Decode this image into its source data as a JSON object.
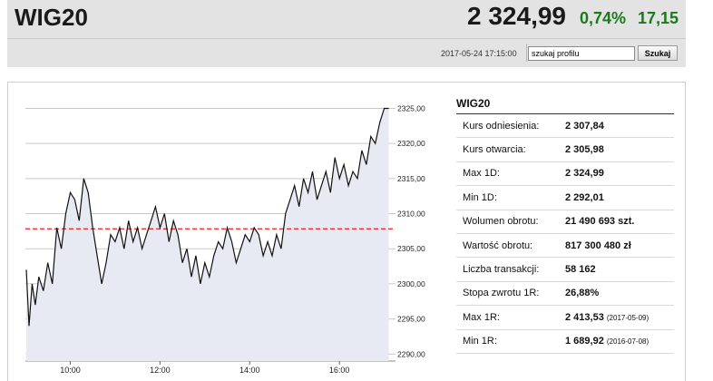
{
  "header": {
    "title": "WIG20",
    "price": "2 324,99",
    "change_pct": "0,74%",
    "change_abs": "17,15",
    "change_color": "#1a7a1a",
    "timestamp": "2017-05-24 17:15:00",
    "search_value": "szukaj profilu",
    "search_button": "Szukaj"
  },
  "stats": {
    "title": "WIG20",
    "rows": [
      {
        "label": "Kurs odniesienia:",
        "value": "2 307,84",
        "date": ""
      },
      {
        "label": "Kurs otwarcia:",
        "value": "2 305,98",
        "date": ""
      },
      {
        "label": "Max 1D:",
        "value": "2 324,99",
        "date": ""
      },
      {
        "label": "Min 1D:",
        "value": "2 292,01",
        "date": ""
      },
      {
        "label": "Wolumen obrotu:",
        "value": "21 490 693 szt.",
        "date": ""
      },
      {
        "label": "Wartość obrotu:",
        "value": "817 300 480 zł",
        "date": ""
      },
      {
        "label": "Liczba transakcji:",
        "value": "58 162",
        "date": ""
      },
      {
        "label": "Stopa zwrotu 1R:",
        "value": "26,88%",
        "date": ""
      },
      {
        "label": "Max 1R:",
        "value": "2 413,53",
        "date": "(2017-05-09)"
      },
      {
        "label": "Min 1R:",
        "value": "1 689,92",
        "date": "(2016-07-08)"
      }
    ]
  },
  "chart_data": {
    "type": "area",
    "title": "",
    "xlabel": "",
    "ylabel": "",
    "x_ticks": [
      {
        "label": "10:00",
        "hours": 10
      },
      {
        "label": "12:00",
        "hours": 12
      },
      {
        "label": "14:00",
        "hours": 14
      },
      {
        "label": "16:00",
        "hours": 16
      }
    ],
    "y_ticks": [
      "2325,00",
      "2320,00",
      "2315,00",
      "2310,00",
      "2305,00",
      "2300,00",
      "2295,00",
      "2290,00"
    ],
    "y_tick_values": [
      2325,
      2320,
      2315,
      2310,
      2305,
      2300,
      2295,
      2290
    ],
    "ylim": [
      2289,
      2327
    ],
    "xlim_hours": [
      9.0,
      17.25
    ],
    "reference_line": {
      "value": 2307.84,
      "color": "#e02020",
      "style": "dashed"
    },
    "line_color": "#111111",
    "fill_color": "#e8eaf3",
    "grid": true,
    "series": [
      {
        "x_hours": [
          9.02,
          9.08,
          9.15,
          9.22,
          9.3,
          9.4,
          9.5,
          9.6,
          9.7,
          9.8,
          9.9,
          10.0,
          10.1,
          10.2,
          10.3,
          10.4,
          10.5,
          10.6,
          10.7,
          10.8,
          10.9,
          11.0,
          11.1,
          11.2,
          11.3,
          11.4,
          11.5,
          11.6,
          11.7,
          11.8,
          11.9,
          12.0,
          12.1,
          12.2,
          12.3,
          12.4,
          12.5,
          12.6,
          12.7,
          12.8,
          12.9,
          13.0,
          13.1,
          13.2,
          13.3,
          13.4,
          13.5,
          13.6,
          13.7,
          13.8,
          13.9,
          14.0,
          14.1,
          14.2,
          14.3,
          14.4,
          14.5,
          14.6,
          14.7,
          14.8,
          14.9,
          15.0,
          15.1,
          15.2,
          15.3,
          15.4,
          15.5,
          15.6,
          15.7,
          15.8,
          15.9,
          16.0,
          16.1,
          16.2,
          16.3,
          16.4,
          16.5,
          16.6,
          16.7,
          16.8,
          16.9,
          17.0,
          17.1
        ],
        "values": [
          2302,
          2294,
          2300,
          2297,
          2301,
          2299,
          2303,
          2300,
          2308,
          2305,
          2310,
          2313,
          2312,
          2309,
          2315,
          2313,
          2308,
          2304,
          2300,
          2303,
          2307,
          2306,
          2308,
          2305,
          2309,
          2306,
          2308,
          2305,
          2307,
          2309,
          2311,
          2308,
          2310,
          2306,
          2309,
          2307,
          2303,
          2305,
          2301,
          2304,
          2300,
          2303,
          2301,
          2304,
          2306,
          2305,
          2308,
          2306,
          2303,
          2305,
          2307,
          2306,
          2308,
          2307,
          2304,
          2306,
          2304,
          2307,
          2305,
          2310,
          2312,
          2314,
          2311,
          2315,
          2313,
          2316,
          2312,
          2314,
          2316,
          2313,
          2318,
          2315,
          2317,
          2314,
          2316,
          2315,
          2319,
          2317,
          2321,
          2320,
          2323,
          2325,
          2325
        ]
      }
    ]
  }
}
